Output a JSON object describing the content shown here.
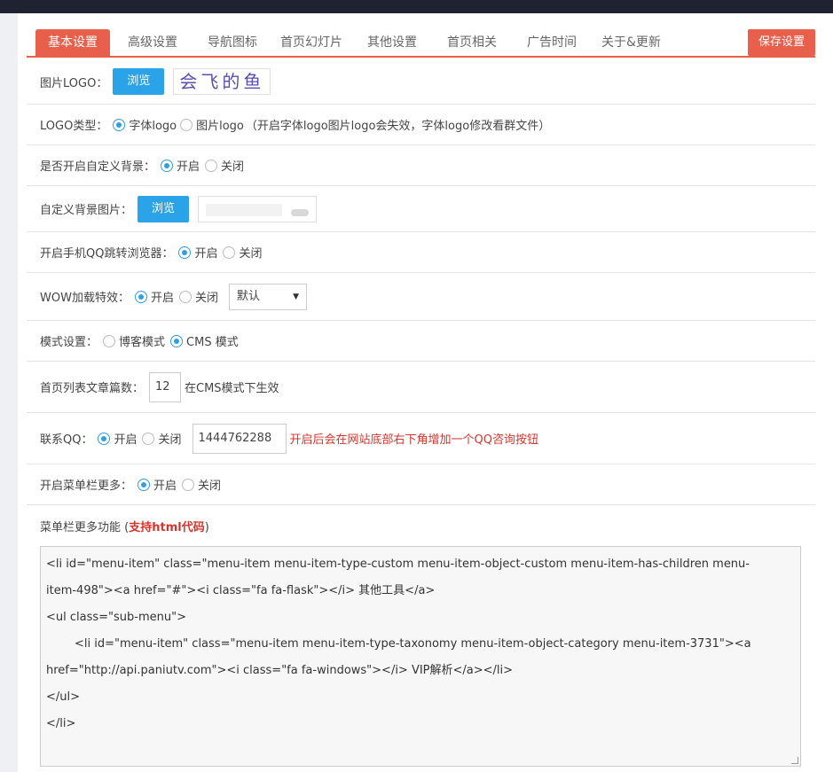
{
  "tabs": [
    "基本设置",
    "高级设置",
    "导航图标",
    "首页幻灯片",
    "其他设置",
    "首页相关",
    "广告时间",
    "关于&更新"
  ],
  "save_button": "保存设置",
  "logo_image": {
    "label": "图片LOGO：",
    "browse": "浏览",
    "preview_text": "会飞的鱼"
  },
  "logo_type": {
    "label": "LOGO类型：",
    "opt1": "字体logo",
    "opt2": "图片logo",
    "note": "（开启字体logo图片logo会失效，字体logo修改看群文件）"
  },
  "custom_bg": {
    "label": "是否开启自定义背景：",
    "on": "开启",
    "off": "关闭"
  },
  "bg_image": {
    "label": "自定义背景图片：",
    "browse": "浏览"
  },
  "qq_browser": {
    "label": "开启手机QQ跳转浏览器：",
    "on": "开启",
    "off": "关闭"
  },
  "wow": {
    "label": "WOW加载特效：",
    "on": "开启",
    "off": "关闭",
    "select_value": "默认"
  },
  "mode": {
    "label": "模式设置：",
    "opt1": "博客模式",
    "opt2": "CMS 模式"
  },
  "article_count": {
    "label": "首页列表文章篇数：",
    "value": "12",
    "note": "在CMS模式下生效"
  },
  "contact_qq": {
    "label": "联系QQ：",
    "on": "开启",
    "off": "关闭",
    "value": "1444762288",
    "note": "开启后会在网站底部右下角增加一个QQ咨询按钮"
  },
  "menu_more": {
    "label": "开启菜单栏更多：",
    "on": "开启",
    "off": "关闭"
  },
  "menu_more_func": {
    "label_prefix": "菜单栏更多功能 (",
    "label_strong": "支持html代码",
    "label_suffix": ")"
  },
  "code_lines": [
    "<li id=\"menu-item\" class=\"menu-item menu-item-type-custom menu-item-object-custom menu-item-has-children menu-",
    "item-498\"><a href=\"#\"><i class=\"fa fa-flask\"></i> 其他工具</a>",
    "<ul class=\"sub-menu\">",
    "<li id=\"menu-item\" class=\"menu-item menu-item-type-taxonomy menu-item-object-category menu-item-3731\"><a",
    "href=\"http://api.paniutv.com\"><i class=\"fa fa-windows\"></i> VIP解析</a></li>",
    "</ul>",
    "</li>"
  ]
}
